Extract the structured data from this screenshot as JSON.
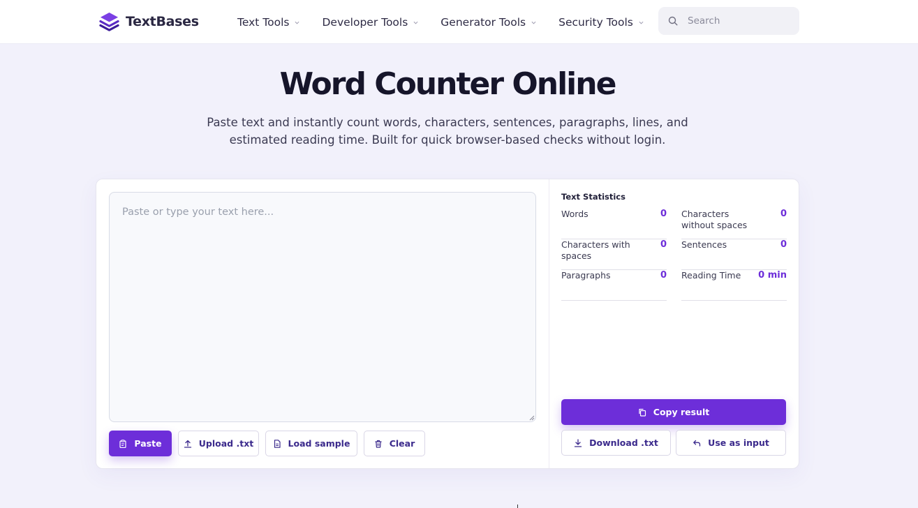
{
  "brand": {
    "name": "TextBases"
  },
  "nav": {
    "items": [
      {
        "label": "Text Tools"
      },
      {
        "label": "Developer Tools"
      },
      {
        "label": "Generator Tools"
      },
      {
        "label": "Security Tools"
      }
    ]
  },
  "search": {
    "placeholder": "Search"
  },
  "hero": {
    "title": "Word Counter Online",
    "subtitle": "Paste text and instantly count words, characters, sentences, paragraphs, lines, and estimated reading time. Built for quick browser-based checks without login."
  },
  "editor": {
    "placeholder": "Paste or type your text here...",
    "value": ""
  },
  "actions": {
    "paste": "Paste",
    "upload": "Upload .txt",
    "load_sample": "Load sample",
    "clear": "Clear"
  },
  "stats": {
    "title": "Text Statistics",
    "items": [
      {
        "label": "Words",
        "value": "0"
      },
      {
        "label": "Characters without spaces",
        "value": "0"
      },
      {
        "label": "Characters with spaces",
        "value": "0"
      },
      {
        "label": "Sentences",
        "value": "0"
      },
      {
        "label": "Paragraphs",
        "value": "0"
      },
      {
        "label": "Reading Time",
        "value": "0 min"
      }
    ]
  },
  "result_actions": {
    "copy": "Copy result",
    "download": "Download .txt",
    "use_as_input": "Use as input"
  },
  "colors": {
    "accent": "#6d2ed9",
    "page_bg": "#f2f1fb",
    "heading": "#16152a"
  }
}
